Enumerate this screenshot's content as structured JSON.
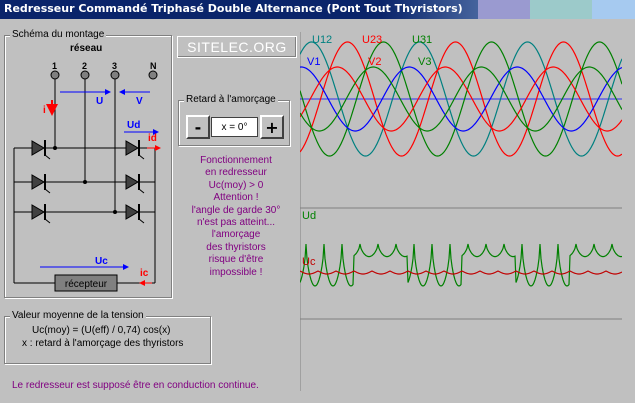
{
  "window": {
    "title": "Redresseur Commandé Triphasé Double Alternance (Pont Tout Thyristors)"
  },
  "schema": {
    "group_label": "Schéma du montage",
    "reseau_label": "réseau",
    "terminals": [
      "1",
      "2",
      "3",
      "N"
    ],
    "labels": {
      "i": "i",
      "U": "U",
      "V": "V",
      "Ud": "Ud",
      "id": "id",
      "Uc": "Uc",
      "ic": "ic"
    },
    "load_label": "récepteur"
  },
  "logo": {
    "text": "SITELEC.ORG"
  },
  "retard": {
    "group_label": "Retard à l'amorçage",
    "minus_label": "-",
    "plus_label": "+",
    "angle_value": "x = 0°"
  },
  "message": {
    "lines": [
      "Fonctionnement",
      "en redresseur",
      "Uc(moy) > 0",
      "Attention !",
      "l'angle de garde 30°",
      "n'est pas atteint...",
      "l'amorçage",
      "des thyristors",
      "risque d'être",
      "impossible !"
    ]
  },
  "average": {
    "group_label": "Valeur moyenne de la tension",
    "formula": "Uc(moy) = (U(eff) / 0,74)  cos(x)",
    "note": "x : retard à l'amorçage des thyristors"
  },
  "footer": {
    "note": "Le redresseur est supposé être en conduction continue."
  },
  "scope": {
    "top_labels": [
      {
        "text": "U12",
        "color": "#008080"
      },
      {
        "text": "U23",
        "color": "#ff0000"
      },
      {
        "text": "U31",
        "color": "#008000"
      },
      {
        "text": "V1",
        "color": "#0000ff"
      },
      {
        "text": "V2",
        "color": "#ff0000"
      },
      {
        "text": "V3",
        "color": "#008000"
      }
    ],
    "ud_label": "Ud",
    "uc_label": "Uc",
    "colors": {
      "ud": "#008000",
      "uc": "#c00000",
      "axis": "#0000ff"
    }
  }
}
